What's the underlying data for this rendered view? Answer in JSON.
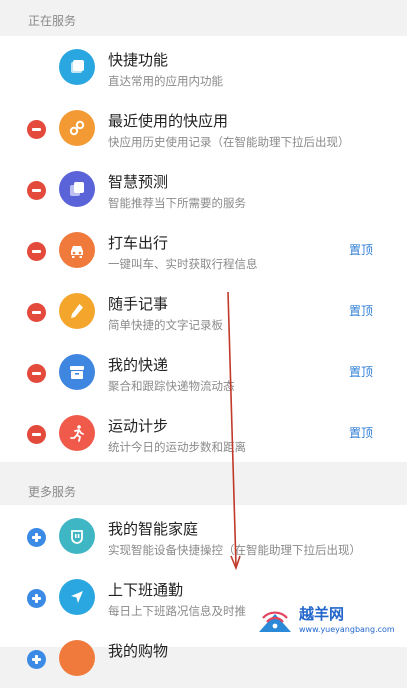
{
  "sections": {
    "active": "正在服务",
    "more": "更多服务"
  },
  "active_items": [
    {
      "title": "快捷功能",
      "subtitle": "直达常用的应用内功能",
      "icon": "layers-icon",
      "color": "#2aa7e0",
      "control": "none",
      "pin": ""
    },
    {
      "title": "最近使用的快应用",
      "subtitle": "快应用历史使用记录（在智能助理下拉后出现）",
      "icon": "link-icon",
      "color": "#f39a35",
      "control": "remove",
      "pin": ""
    },
    {
      "title": "智慧预测",
      "subtitle": "智能推荐当下所需要的服务",
      "icon": "cards-icon",
      "color": "#5b63d9",
      "control": "remove",
      "pin": ""
    },
    {
      "title": "打车出行",
      "subtitle": "一键叫车、实时获取行程信息",
      "icon": "car-icon",
      "color": "#f07a3b",
      "control": "remove",
      "pin": "置顶"
    },
    {
      "title": "随手记事",
      "subtitle": "简单快捷的文字记录板",
      "icon": "pen-icon",
      "color": "#f3a62b",
      "control": "remove",
      "pin": "置顶"
    },
    {
      "title": "我的快递",
      "subtitle": "聚合和跟踪快递物流动态",
      "icon": "box-icon",
      "color": "#3f86e0",
      "control": "remove",
      "pin": "置顶"
    },
    {
      "title": "运动计步",
      "subtitle": "统计今日的运动步数和距离",
      "icon": "runner-icon",
      "color": "#ef5a4a",
      "control": "remove",
      "pin": "置顶"
    }
  ],
  "more_items": [
    {
      "title": "我的智能家庭",
      "subtitle": "实现智能设备快捷操控（在智能助理下拉后出现）",
      "icon": "home-device-icon",
      "color": "#3fb6c4",
      "control": "add"
    },
    {
      "title": "上下班通勤",
      "subtitle": "每日上下班路况信息及时推",
      "icon": "navigation-icon",
      "color": "#2aa7e0",
      "control": "add"
    },
    {
      "title": "我的购物",
      "subtitle": "",
      "icon": "cart-icon",
      "color": "#f07a3b",
      "control": "add"
    }
  ],
  "watermark": {
    "text": "越羊网",
    "url": "www.yueyangbang.com"
  }
}
